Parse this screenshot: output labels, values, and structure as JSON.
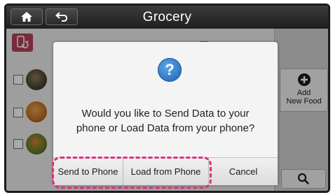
{
  "header": {
    "title": "Grocery",
    "home_icon": "home-icon",
    "back_icon": "back-arrow-icon"
  },
  "sidebar": {
    "add_food_label_line1": "Add",
    "add_food_label_line2": "New Food",
    "add_icon": "plus-circle-icon",
    "search_icon": "search-icon"
  },
  "list": {
    "sync_icon": "phone-sync-icon",
    "items": [
      {
        "icon": "shellfish-food-image"
      },
      {
        "icon": "grain-food-image"
      },
      {
        "icon": "vegetable-food-image"
      }
    ]
  },
  "dialog": {
    "icon": "question-icon",
    "message_line1": "Would you like to Send Data to your",
    "message_line2": "phone or Load Data from your phone?",
    "buttons": {
      "send": "Send to Phone",
      "load": "Load from Phone",
      "cancel": "Cancel"
    }
  },
  "colors": {
    "highlight": "#e0307f",
    "sync_button": "#b0405a",
    "question_icon": "#1d62b4"
  }
}
